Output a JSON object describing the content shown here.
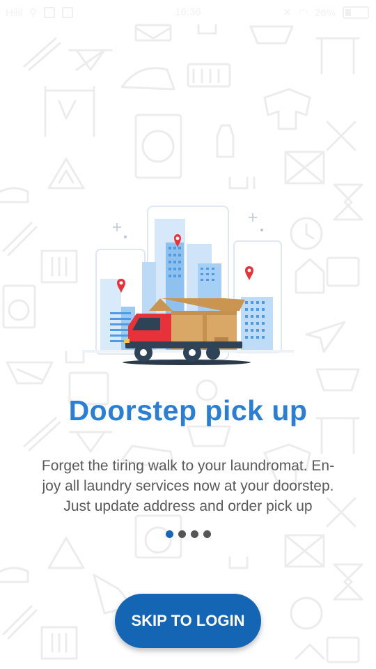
{
  "status_bar": {
    "carrier": "Hiiil",
    "time": "16:36",
    "battery": "26%"
  },
  "background_icons": [
    "laundry-pattern-icons"
  ],
  "slide": {
    "title": "Doorstep pick up",
    "description_lines": [
      "Forget the tiring walk to your laundromat. En-",
      "joy all laundry services now at your doorstep.",
      "Just update address and order pick up"
    ],
    "page_indicator": {
      "total": 4,
      "active_index": 0
    }
  },
  "skip_button": {
    "label": "SKIP TO LOGIN"
  },
  "colors": {
    "title": "#2a7fd4",
    "button": "#1565b5",
    "dot_active": "#1666b8",
    "dot_inactive": "#555555",
    "truck_red": "#e8323a",
    "box": "#d9a866",
    "pin": "#e8323a"
  }
}
